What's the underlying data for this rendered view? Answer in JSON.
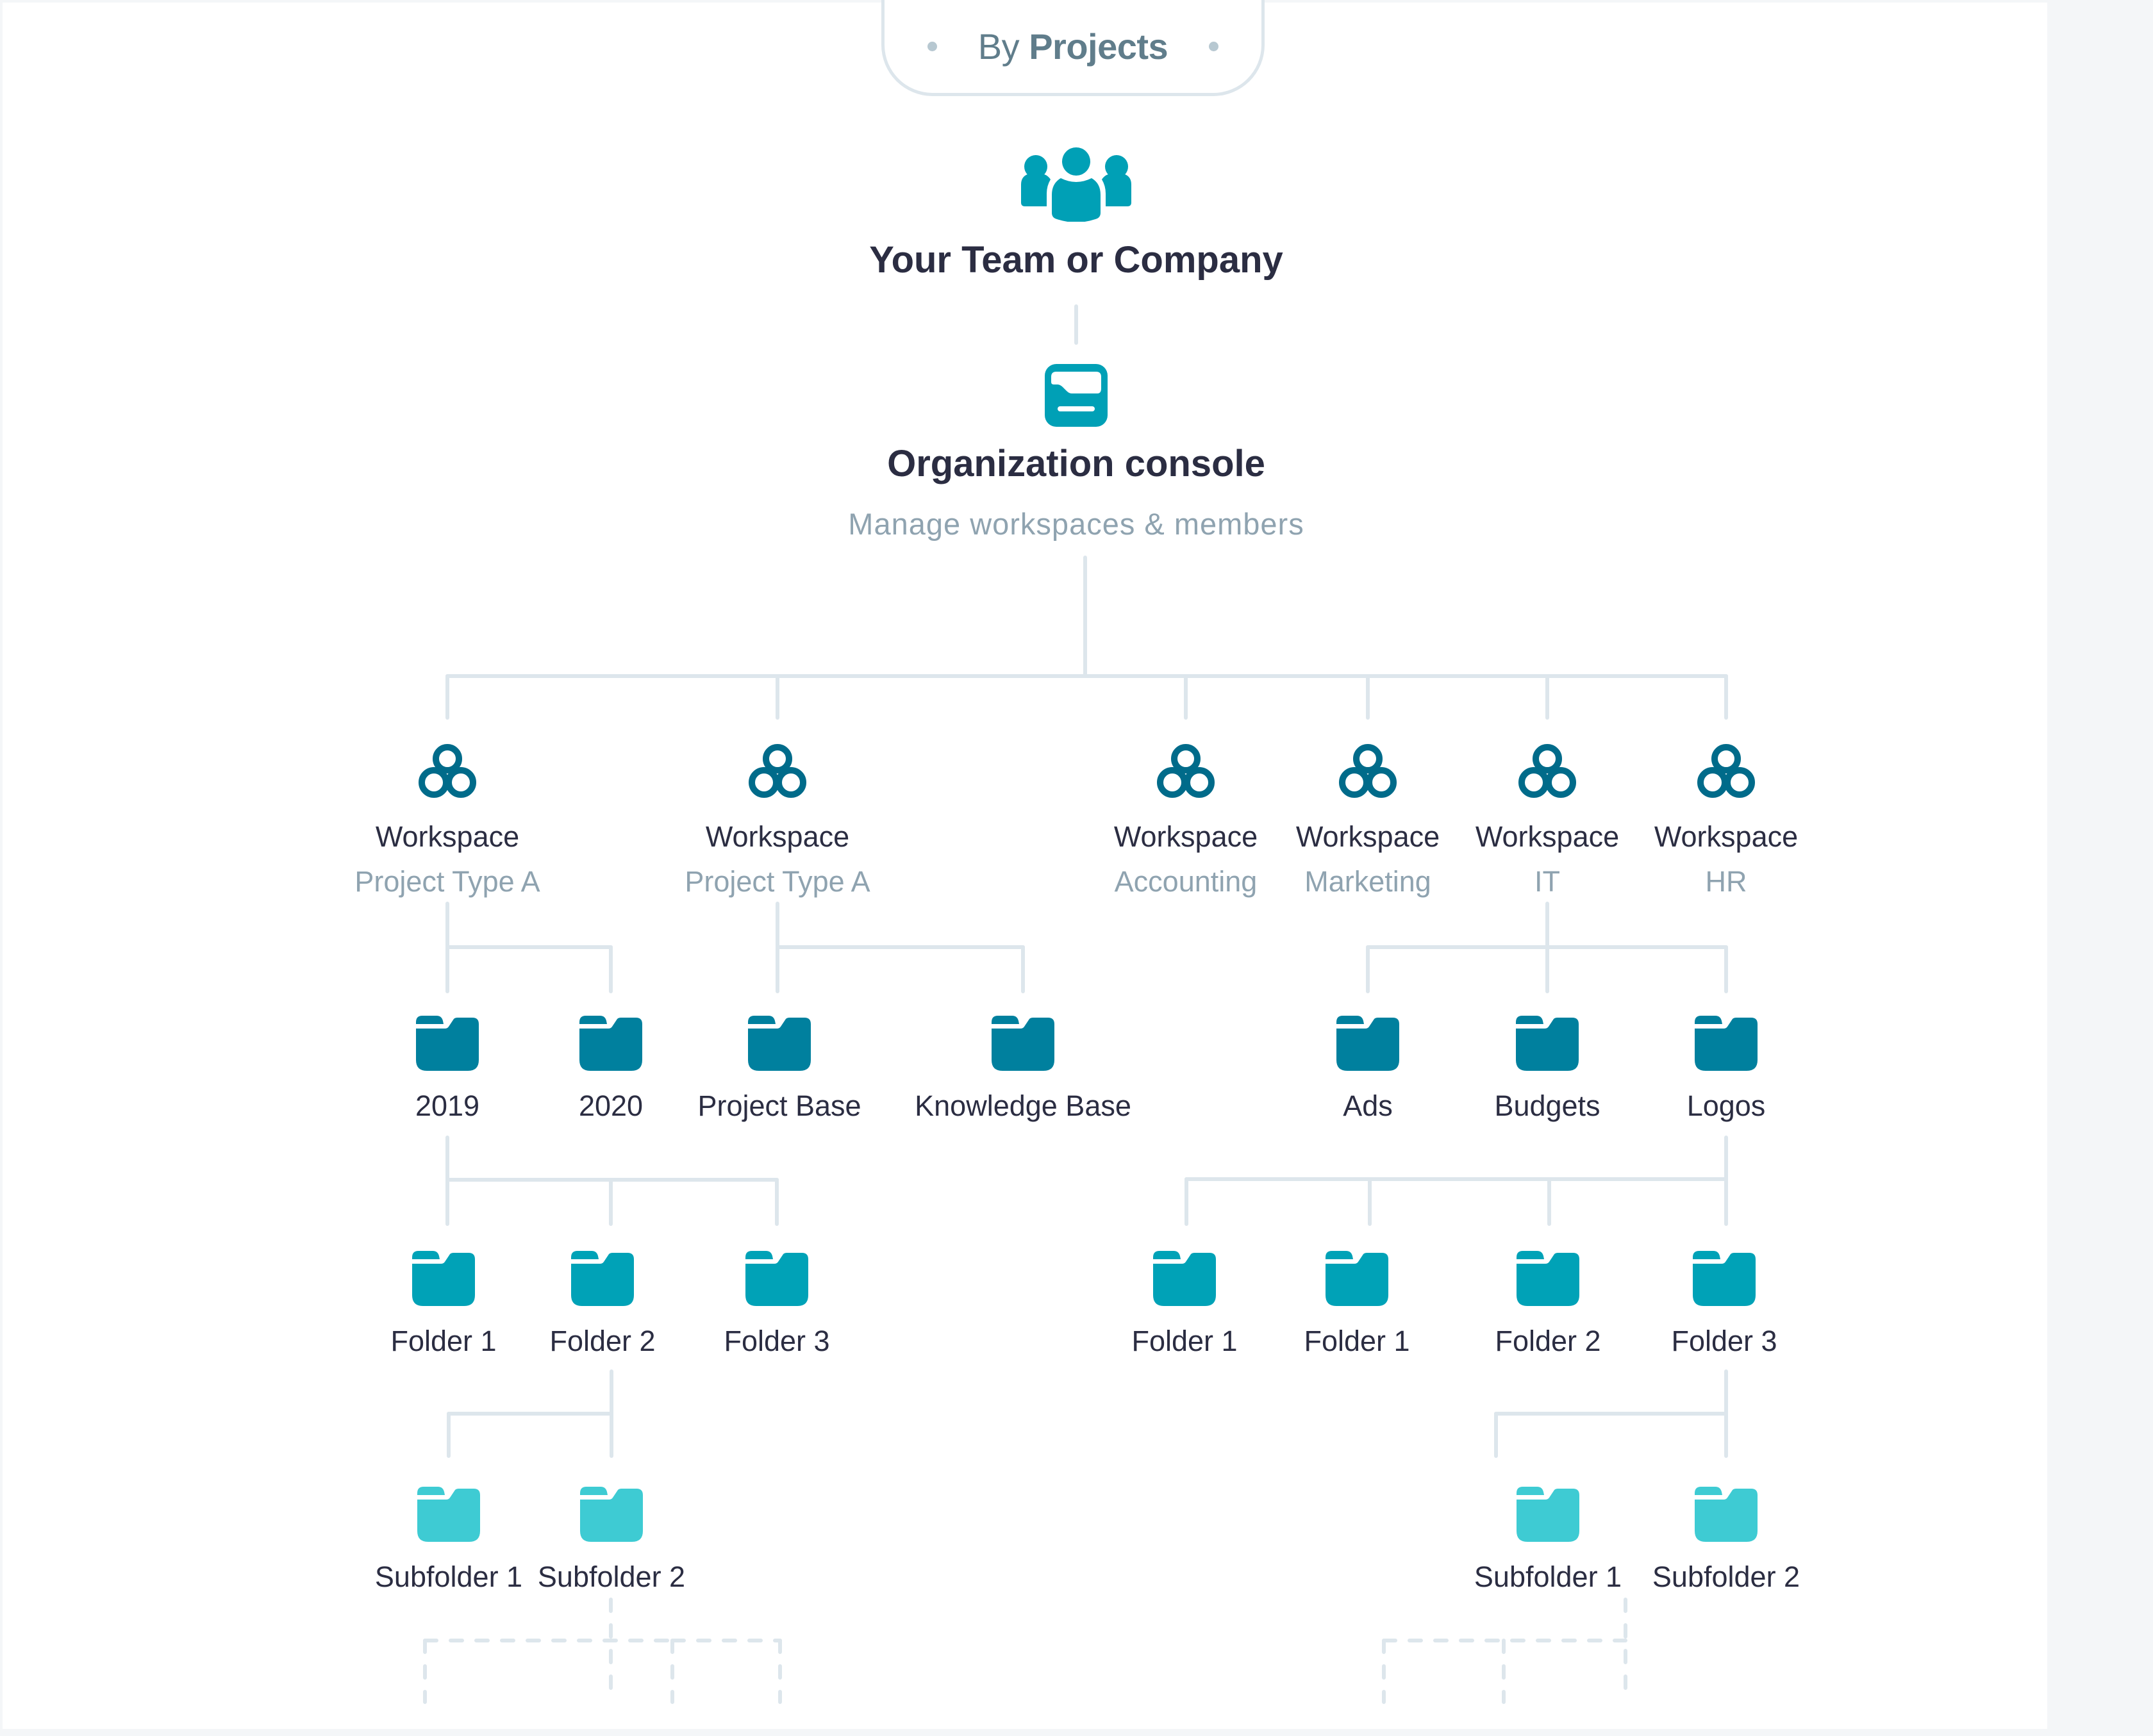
{
  "tab": {
    "prefix": "By",
    "emphasis": "Projects"
  },
  "root": {
    "icon": "team-icon",
    "title": "Your Team or Company"
  },
  "console": {
    "icon": "organization-console-icon",
    "title": "Organization console",
    "subtitle": "Manage workspaces & members"
  },
  "colors": {
    "team_icon": "#00a0b6",
    "workspace_icon": "#006b8a",
    "folder_level1": "#00809e",
    "folder_level2": "#00a2b7",
    "folder_level3": "#3ecbd3",
    "connector": "#dde6ec",
    "text_dark": "#2b2d42",
    "text_muted": "#8fa3b0",
    "tab_text": "#607d8b"
  },
  "workspaces": [
    {
      "label": "Workspace",
      "type": "Project Type A"
    },
    {
      "label": "Workspace",
      "type": "Project Type A"
    },
    {
      "label": "Workspace",
      "type": "Accounting"
    },
    {
      "label": "Workspace",
      "type": "Marketing"
    },
    {
      "label": "Workspace",
      "type": "IT"
    },
    {
      "label": "Workspace",
      "type": "HR"
    }
  ],
  "folders_level1": [
    {
      "label": "2019",
      "parent": "Workspace Project Type A (1)"
    },
    {
      "label": "2020",
      "parent": "Workspace Project Type A (1)"
    },
    {
      "label": "Project Base",
      "parent": "Workspace Project Type A (2)"
    },
    {
      "label": "Knowledge Base",
      "parent": "Workspace Project Type A (2)"
    },
    {
      "label": "Ads",
      "parent": "Workspace IT"
    },
    {
      "label": "Budgets",
      "parent": "Workspace IT"
    },
    {
      "label": "Logos",
      "parent": "Workspace IT"
    }
  ],
  "folders_level2": [
    {
      "label": "Folder 1",
      "parent": "2019"
    },
    {
      "label": "Folder 2",
      "parent": "2019"
    },
    {
      "label": "Folder 3",
      "parent": "2019"
    },
    {
      "label": "Folder 1",
      "parent": "Logos"
    },
    {
      "label": "Folder 1",
      "parent": "Logos"
    },
    {
      "label": "Folder 2",
      "parent": "Logos"
    },
    {
      "label": "Folder 3",
      "parent": "Logos"
    }
  ],
  "folders_level3": [
    {
      "label": "Subfolder 1",
      "parent": "Folder 2"
    },
    {
      "label": "Subfolder 2",
      "parent": "Folder 2"
    },
    {
      "label": "Subfolder 1",
      "parent": "Folder 3"
    },
    {
      "label": "Subfolder 2",
      "parent": "Folder 3"
    }
  ]
}
